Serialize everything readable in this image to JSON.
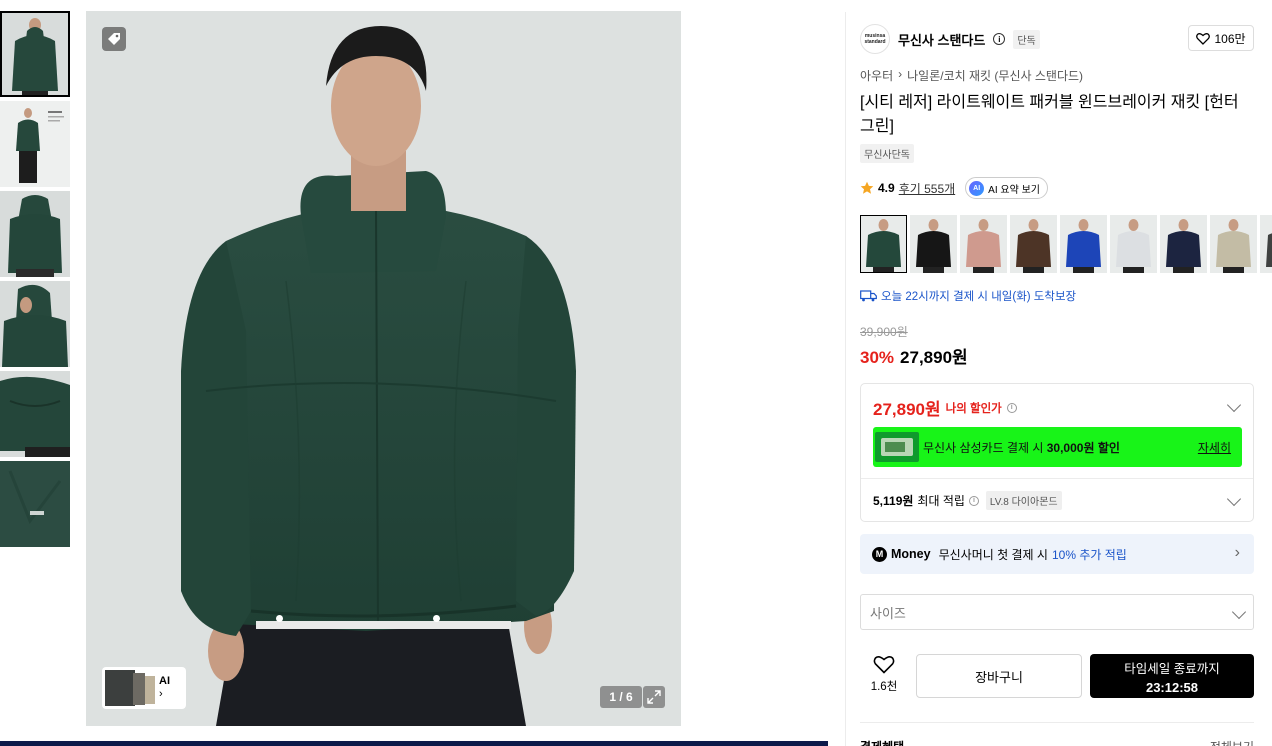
{
  "gallery": {
    "counter": "1 / 6",
    "ai_label": "AI",
    "thumbnails": [
      "thumb-1",
      "thumb-2",
      "thumb-3",
      "thumb-4",
      "thumb-5",
      "thumb-6"
    ],
    "selected_thumbnail": 0
  },
  "brand": {
    "logo_text": "musinsa standard",
    "name": "무신사 스탠다드",
    "exclusive_chip": "단독",
    "like_count": "106만"
  },
  "breadcrumb": [
    "아우터",
    "나일론/코치 재킷 (무신사 스탠다드)"
  ],
  "product": {
    "title": "[시티 레저] 라이트웨이트 패커블 윈드브레이커 재킷 [헌터 그린]",
    "exclusive_tag": "무신사단독",
    "rating": "4.9",
    "reviews": "후기 555개",
    "ai_summary": "AI 요약 보기",
    "ai_badge": "AI"
  },
  "colors": [
    {
      "name": "헌터 그린",
      "hex": "#24483b"
    },
    {
      "name": "블랙",
      "hex": "#161616"
    },
    {
      "name": "핑크",
      "hex": "#cf9a8e"
    },
    {
      "name": "브라운",
      "hex": "#4d3426"
    },
    {
      "name": "블루",
      "hex": "#1d45b8"
    },
    {
      "name": "화이트",
      "hex": "#dcdfe2"
    },
    {
      "name": "네이비",
      "hex": "#1c2440"
    },
    {
      "name": "베이지",
      "hex": "#c3bca5"
    },
    {
      "name": "차콜",
      "hex": "#3f4140"
    }
  ],
  "delivery": "오늘 22시까지 결제 시 내일(화) 도착보장",
  "pricing": {
    "original": "39,900원",
    "discount": "30%",
    "price": "27,890원",
    "my_price": "27,890원",
    "my_price_label": "나의 할인가",
    "card_promo_prefix": "무신사 삼성카드 결제 시 ",
    "card_promo_amount": "30,000원 할인",
    "card_promo_more": "자세히",
    "points_amount": "5,119원",
    "points_label": "최대 적립",
    "points_level": "LV.8 다이아몬드"
  },
  "money": {
    "icon": "M",
    "word": "Money",
    "text": "무신사머니 첫 결제 시 ",
    "highlight": "10% 추가 적립"
  },
  "size_select": {
    "placeholder": "사이즈"
  },
  "actions": {
    "wish_count": "1.6천",
    "cart": "장바구니",
    "buy_line1": "타임세일 종료까지",
    "buy_line2": "23:12:58"
  },
  "benefits": {
    "title": "결제혜택",
    "view_all": "전체보기"
  },
  "theme": {
    "accent_red": "#e5221c",
    "link_blue": "#1a54c9",
    "promo_green": "#18f418"
  }
}
